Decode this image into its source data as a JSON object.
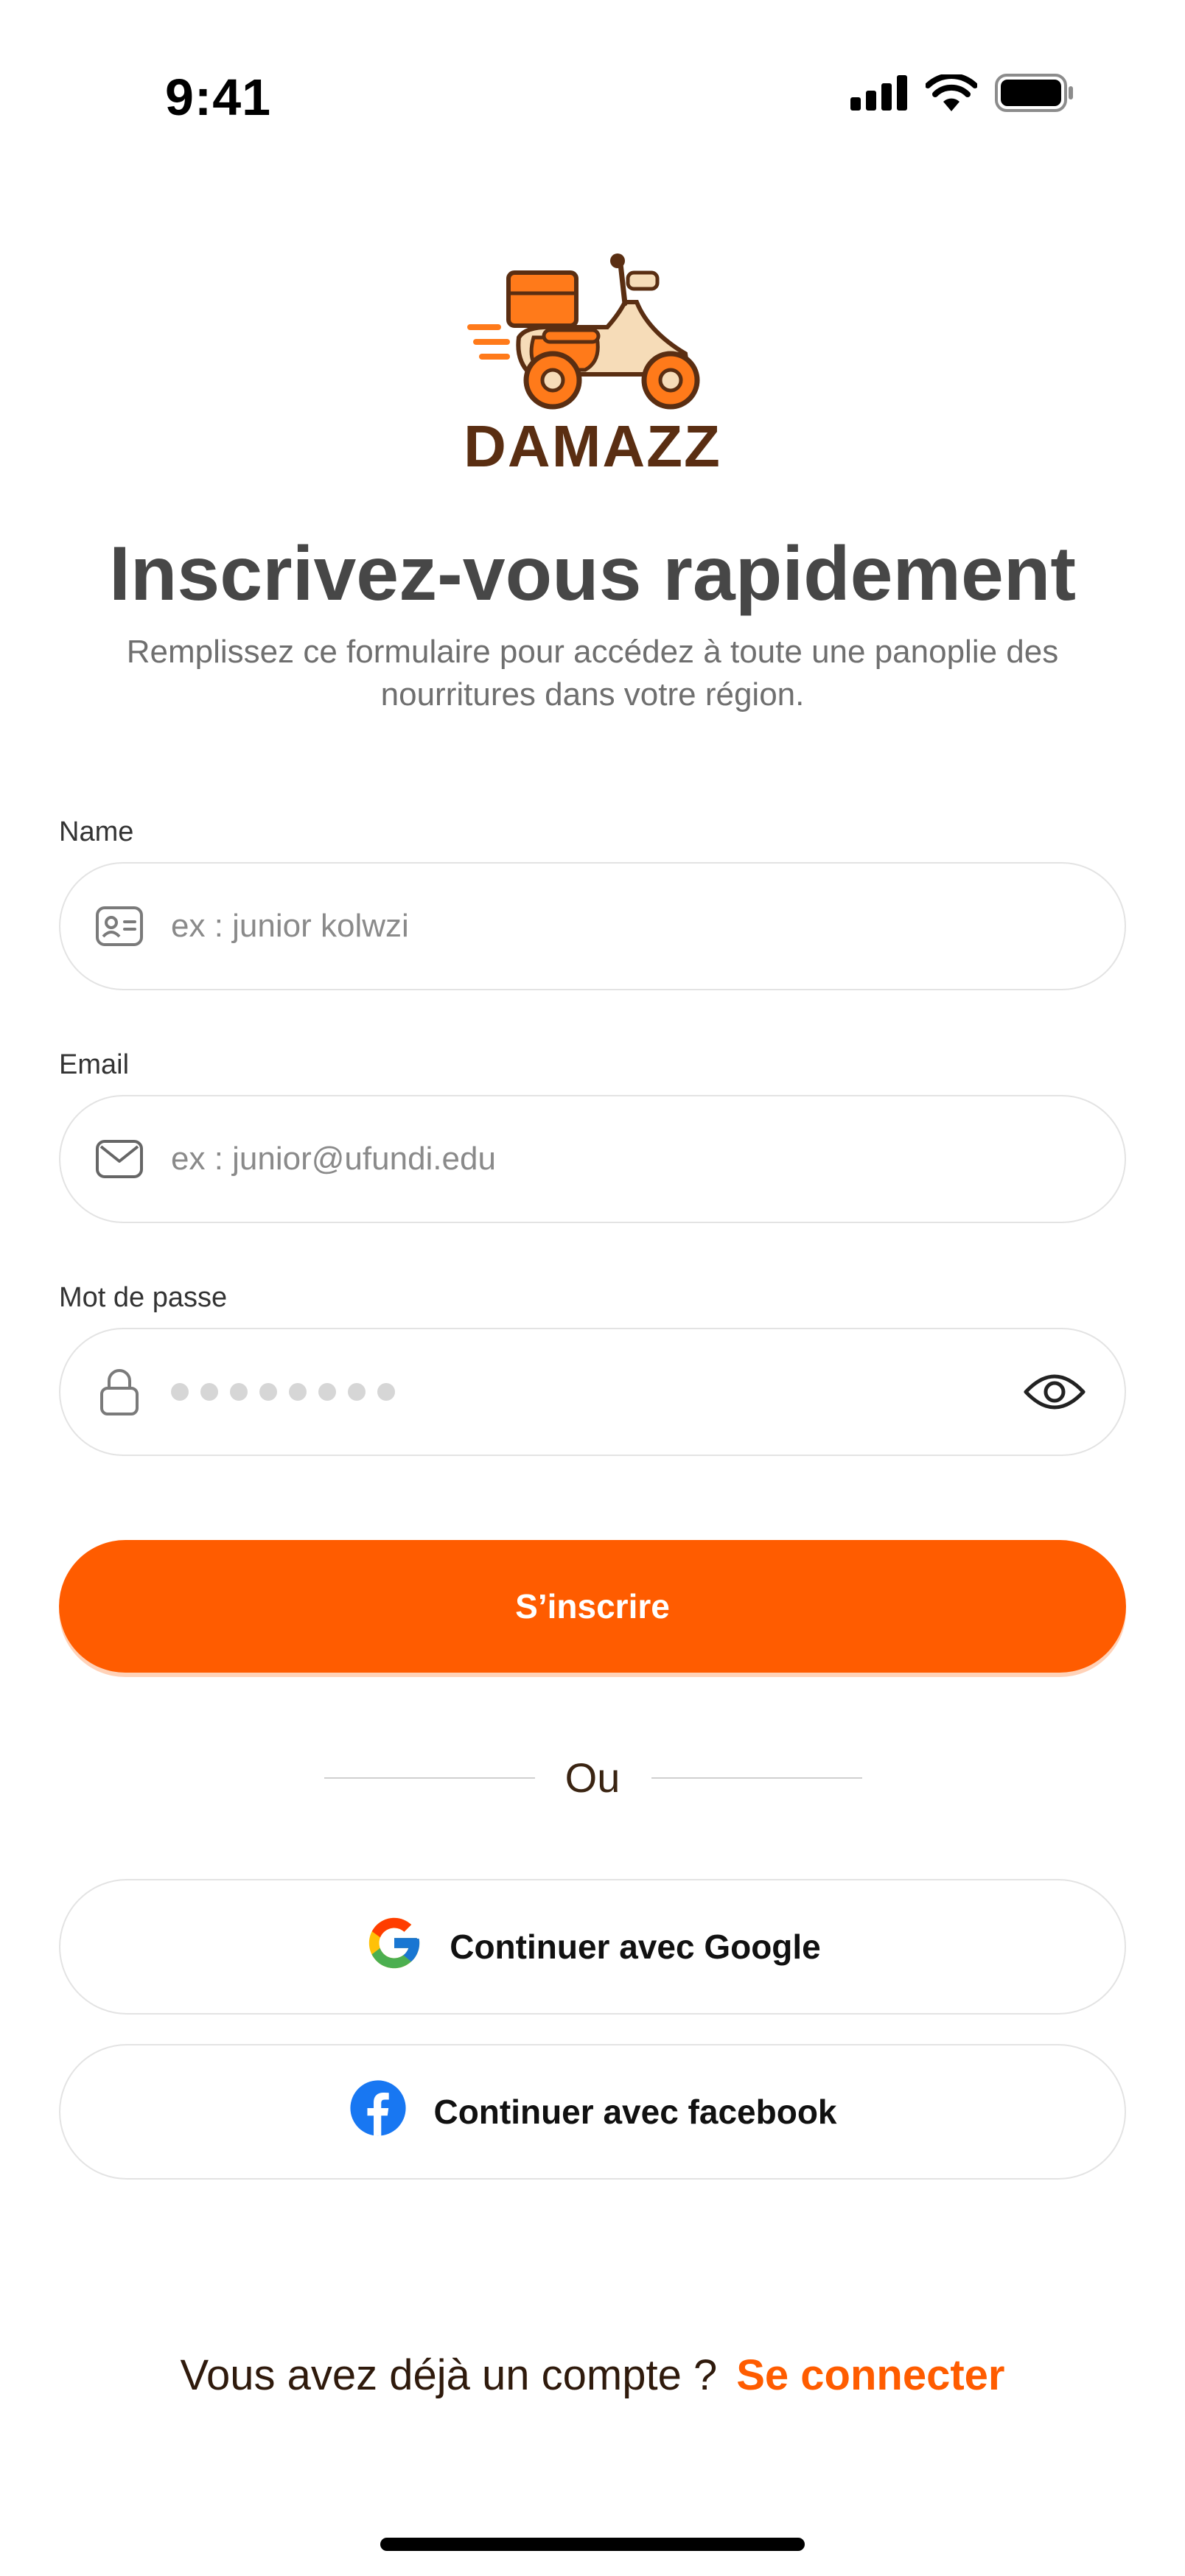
{
  "status_bar": {
    "time": "9:41"
  },
  "brand": {
    "name": "DAMAZZ"
  },
  "header": {
    "title": "Inscrivez-vous rapidement",
    "subtitle": "Remplissez ce formulaire pour accédez à toute une panoplie des nourritures dans votre région."
  },
  "form": {
    "name": {
      "label": "Name",
      "placeholder": "ex : junior kolwzi"
    },
    "email": {
      "label": "Email",
      "placeholder": "ex : junior@ufundi.edu"
    },
    "password": {
      "label": "Mot de passe",
      "masked_length": 8
    },
    "submit_label": "S’inscrire"
  },
  "divider": {
    "label": "Ou"
  },
  "social": {
    "google_label": "Continuer avec Google",
    "facebook_label": "Continuer avec facebook"
  },
  "footer": {
    "prompt": "Vous avez déjà un compte ?",
    "link": "Se connecter"
  },
  "colors": {
    "accent": "#ff5c00",
    "brand_brown": "#5a2e12",
    "title_gray": "#474747",
    "facebook_blue": "#1877f2"
  },
  "icons": {
    "signal": "cellular-signal-icon",
    "wifi": "wifi-icon",
    "battery": "battery-icon",
    "name_field": "id-card-icon",
    "email_field": "mail-icon",
    "password_field": "lock-icon",
    "password_toggle": "eye-icon",
    "google": "google-logo-icon",
    "facebook": "facebook-logo-icon"
  }
}
